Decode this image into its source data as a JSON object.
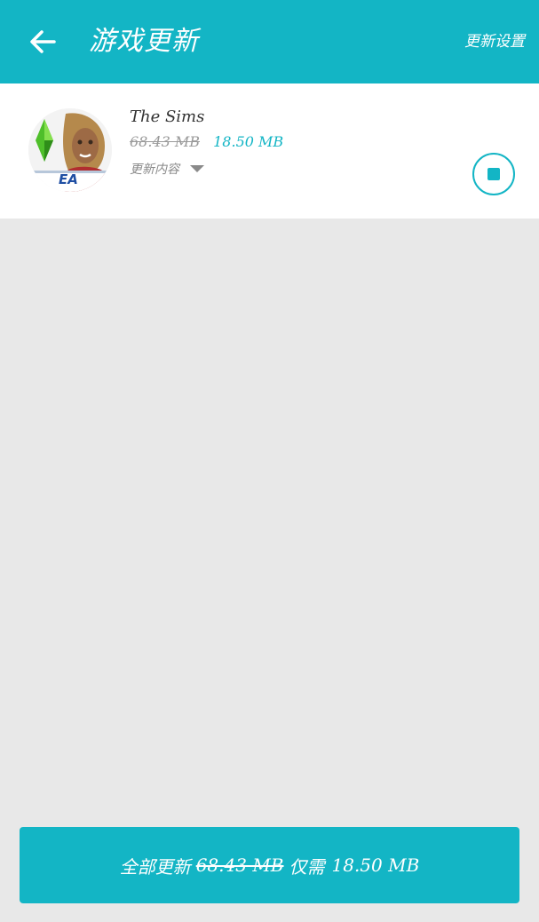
{
  "header": {
    "title": "游戏更新",
    "settings_label": "更新设置",
    "back_icon": "arrow-left-icon"
  },
  "update_item": {
    "name": "The Sims",
    "old_size": "68.43 MB",
    "new_size": "18.50 MB",
    "changelog_label": "更新内容",
    "changelog_icon": "chevron-down-icon",
    "action_icon": "stop-icon",
    "icon_publisher": "EA"
  },
  "footer": {
    "prefix": "全部更新",
    "old_size": "68.43 MB",
    "middle": "仅需",
    "new_size": "18.50 MB"
  },
  "colors": {
    "accent": "#13b5c5",
    "background": "#e8e8e8",
    "card": "#ffffff"
  }
}
